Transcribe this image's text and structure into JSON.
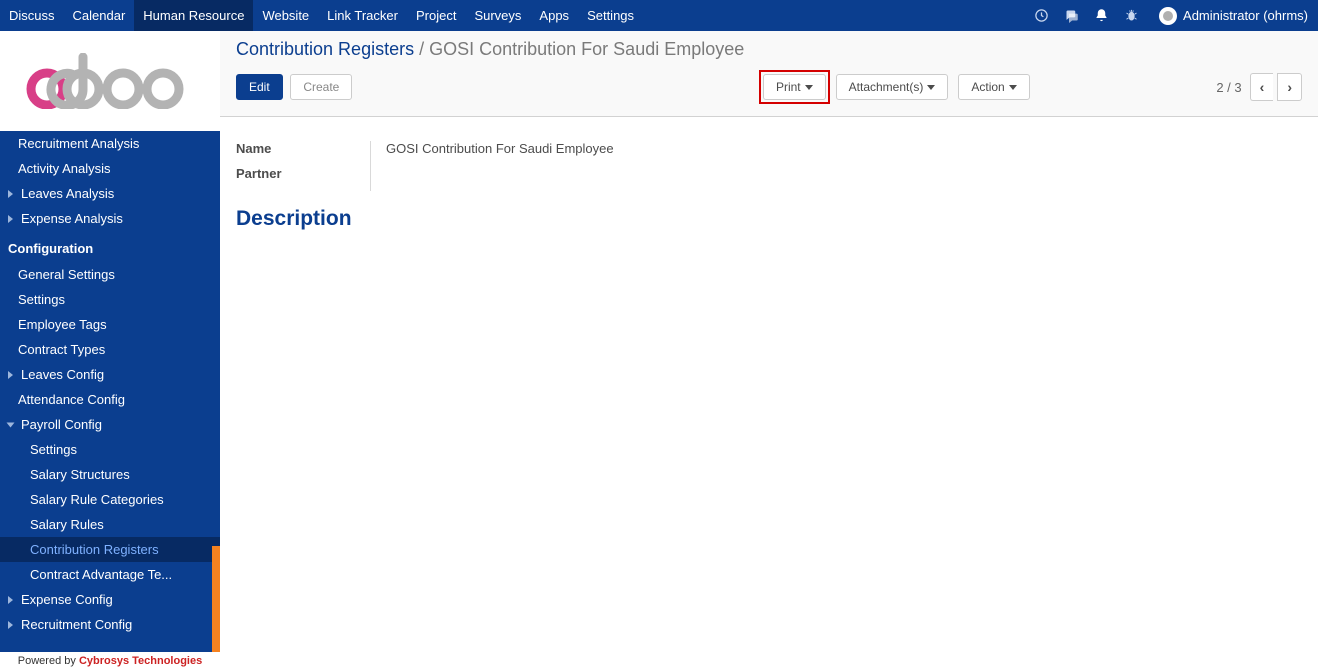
{
  "navbar": {
    "items": [
      "Discuss",
      "Calendar",
      "Human Resource",
      "Website",
      "Link Tracker",
      "Project",
      "Surveys",
      "Apps",
      "Settings"
    ],
    "active_index": 2,
    "user_label": "Administrator (ohrms)"
  },
  "sidebar": {
    "top_items": [
      "Recruitment Analysis",
      "Activity Analysis",
      "Leaves Analysis",
      "Expense Analysis"
    ],
    "top_caret": [
      false,
      false,
      true,
      true
    ],
    "section_header": "Configuration",
    "config_items": [
      {
        "label": "General Settings",
        "caret": false,
        "level": 1
      },
      {
        "label": "Settings",
        "caret": false,
        "level": 1
      },
      {
        "label": "Employee Tags",
        "caret": false,
        "level": 1
      },
      {
        "label": "Contract Types",
        "caret": false,
        "level": 1
      },
      {
        "label": "Leaves Config",
        "caret": true,
        "level": 1
      },
      {
        "label": "Attendance Config",
        "caret": false,
        "level": 1
      },
      {
        "label": "Payroll Config",
        "caret": true,
        "level": 1,
        "expanded": true
      },
      {
        "label": "Settings",
        "caret": false,
        "level": 2
      },
      {
        "label": "Salary Structures",
        "caret": false,
        "level": 2
      },
      {
        "label": "Salary Rule Categories",
        "caret": false,
        "level": 2
      },
      {
        "label": "Salary Rules",
        "caret": false,
        "level": 2
      },
      {
        "label": "Contribution Registers",
        "caret": false,
        "level": 2,
        "active": true
      },
      {
        "label": "Contract Advantage Te...",
        "caret": false,
        "level": 2
      },
      {
        "label": "Expense Config",
        "caret": true,
        "level": 1
      },
      {
        "label": "Recruitment Config",
        "caret": true,
        "level": 1
      }
    ],
    "powered_label": "Powered by ",
    "powered_company": "Cybrosys Technologies"
  },
  "breadcrumb": {
    "root": "Contribution Registers",
    "sep": " / ",
    "current": "GOSI Contribution For Saudi Employee"
  },
  "toolbar": {
    "edit": "Edit",
    "create": "Create",
    "print": "Print ",
    "attachments": "Attachment(s) ",
    "action": "Action "
  },
  "pager": {
    "text": "2 / 3"
  },
  "form": {
    "name_label": "Name",
    "name_value": "GOSI Contribution For Saudi Employee",
    "partner_label": "Partner",
    "description_title": "Description"
  }
}
